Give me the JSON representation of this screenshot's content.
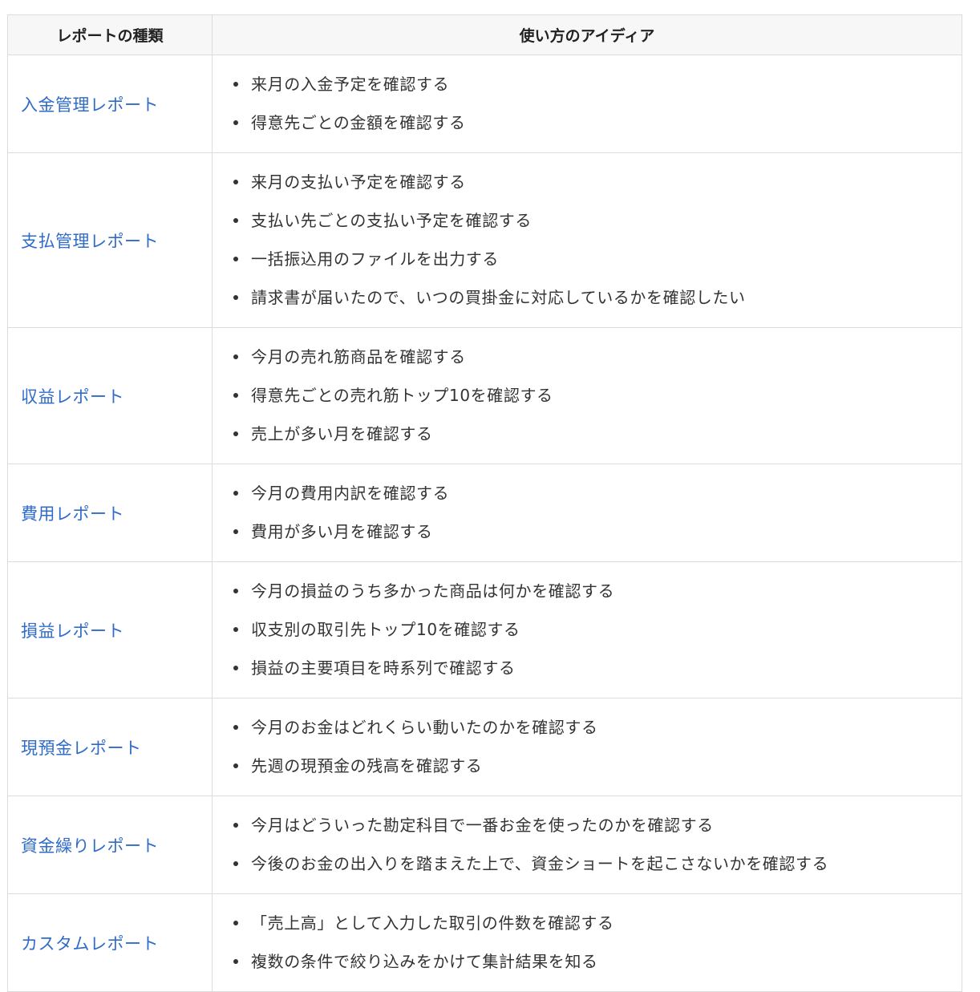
{
  "table": {
    "headers": {
      "type": "レポートの種類",
      "ideas": "使い方のアイディア"
    },
    "rows": [
      {
        "type": "入金管理レポート",
        "ideas": [
          "来月の入金予定を確認する",
          "得意先ごとの金額を確認する"
        ]
      },
      {
        "type": "支払管理レポート",
        "ideas": [
          "来月の支払い予定を確認する",
          "支払い先ごとの支払い予定を確認する",
          "一括振込用のファイルを出力する",
          "請求書が届いたので、いつの買掛金に対応しているかを確認したい"
        ]
      },
      {
        "type": "収益レポート",
        "ideas": [
          "今月の売れ筋商品を確認する",
          "得意先ごとの売れ筋トップ10を確認する",
          "売上が多い月を確認する"
        ]
      },
      {
        "type": "費用レポート",
        "ideas": [
          "今月の費用内訳を確認する",
          "費用が多い月を確認する"
        ]
      },
      {
        "type": "損益レポート",
        "ideas": [
          "今月の損益のうち多かった商品は何かを確認する",
          "収支別の取引先トップ10を確認する",
          "損益の主要項目を時系列で確認する"
        ]
      },
      {
        "type": "現預金レポート",
        "ideas": [
          "今月のお金はどれくらい動いたのかを確認する",
          "先週の現預金の残高を確認する"
        ]
      },
      {
        "type": "資金繰りレポート",
        "ideas": [
          "今月はどういった勘定科目で一番お金を使ったのかを確認する",
          "今後のお金の出入りを踏まえた上で、資金ショートを起こさないかを確認する"
        ]
      },
      {
        "type": "カスタムレポート",
        "ideas": [
          "「売上高」として入力した取引の件数を確認する",
          "複数の条件で絞り込みをかけて集計結果を知る"
        ]
      }
    ]
  }
}
